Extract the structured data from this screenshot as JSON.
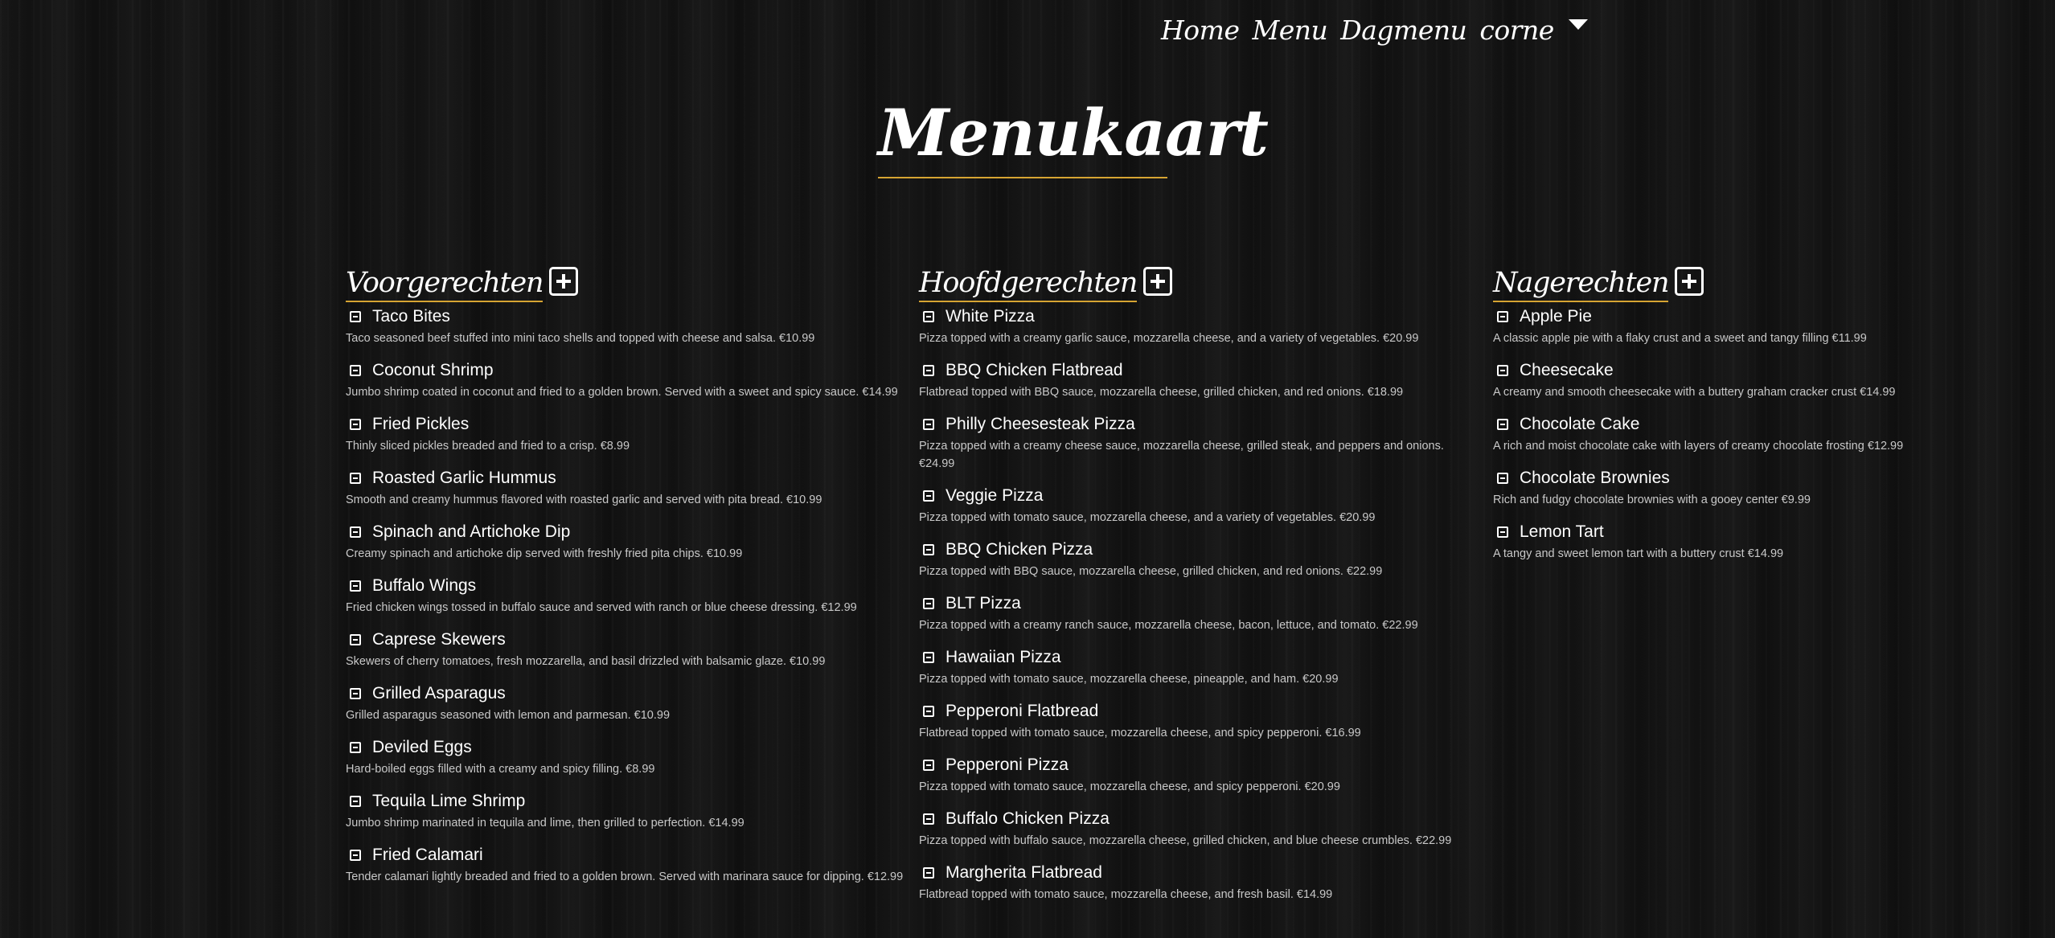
{
  "nav": {
    "items": [
      "Home",
      "Menu",
      "Dagmenu",
      "corne"
    ]
  },
  "page": {
    "title": "Menukaart"
  },
  "colors": {
    "accent": "#d6a432",
    "background": "#141414",
    "text": "#ffffff"
  },
  "categories": [
    {
      "title": "Voorgerechten",
      "items": [
        {
          "name": "Taco Bites",
          "desc": "Taco seasoned beef stuffed into mini taco shells and topped with cheese and salsa. €10.99"
        },
        {
          "name": "Coconut Shrimp",
          "desc": "Jumbo shrimp coated in coconut and fried to a golden brown. Served with a sweet and spicy sauce. €14.99"
        },
        {
          "name": "Fried Pickles",
          "desc": "Thinly sliced pickles breaded and fried to a crisp. €8.99"
        },
        {
          "name": "Roasted Garlic Hummus",
          "desc": "Smooth and creamy hummus flavored with roasted garlic and served with pita bread. €10.99"
        },
        {
          "name": "Spinach and Artichoke Dip",
          "desc": "Creamy spinach and artichoke dip served with freshly fried pita chips. €10.99"
        },
        {
          "name": "Buffalo Wings",
          "desc": "Fried chicken wings tossed in buffalo sauce and served with ranch or blue cheese dressing. €12.99"
        },
        {
          "name": "Caprese Skewers",
          "desc": "Skewers of cherry tomatoes, fresh mozzarella, and basil drizzled with balsamic glaze. €10.99"
        },
        {
          "name": "Grilled Asparagus",
          "desc": "Grilled asparagus seasoned with lemon and parmesan. €10.99"
        },
        {
          "name": "Deviled Eggs",
          "desc": "Hard-boiled eggs filled with a creamy and spicy filling. €8.99"
        },
        {
          "name": "Tequila Lime Shrimp",
          "desc": "Jumbo shrimp marinated in tequila and lime, then grilled to perfection. €14.99"
        },
        {
          "name": "Fried Calamari",
          "desc": "Tender calamari lightly breaded and fried to a golden brown. Served with marinara sauce for dipping. €12.99"
        }
      ]
    },
    {
      "title": "Hoofdgerechten",
      "items": [
        {
          "name": "White Pizza",
          "desc": "Pizza topped with a creamy garlic sauce, mozzarella cheese, and a variety of vegetables. €20.99"
        },
        {
          "name": "BBQ Chicken Flatbread",
          "desc": "Flatbread topped with BBQ sauce, mozzarella cheese, grilled chicken, and red onions. €18.99"
        },
        {
          "name": "Philly Cheesesteak Pizza",
          "desc": "Pizza topped with a creamy cheese sauce, mozzarella cheese, grilled steak, and peppers and onions. €24.99"
        },
        {
          "name": "Veggie Pizza",
          "desc": "Pizza topped with tomato sauce, mozzarella cheese, and a variety of vegetables. €20.99"
        },
        {
          "name": "BBQ Chicken Pizza",
          "desc": "Pizza topped with BBQ sauce, mozzarella cheese, grilled chicken, and red onions. €22.99"
        },
        {
          "name": "BLT Pizza",
          "desc": "Pizza topped with a creamy ranch sauce, mozzarella cheese, bacon, lettuce, and tomato. €22.99"
        },
        {
          "name": "Hawaiian Pizza",
          "desc": "Pizza topped with tomato sauce, mozzarella cheese, pineapple, and ham. €20.99"
        },
        {
          "name": "Pepperoni Flatbread",
          "desc": "Flatbread topped with tomato sauce, mozzarella cheese, and spicy pepperoni. €16.99"
        },
        {
          "name": "Pepperoni Pizza",
          "desc": "Pizza topped with tomato sauce, mozzarella cheese, and spicy pepperoni. €20.99"
        },
        {
          "name": "Buffalo Chicken Pizza",
          "desc": "Pizza topped with buffalo sauce, mozzarella cheese, grilled chicken, and blue cheese crumbles. €22.99"
        },
        {
          "name": "Margherita Flatbread",
          "desc": "Flatbread topped with tomato sauce, mozzarella cheese, and fresh basil. €14.99"
        }
      ]
    },
    {
      "title": "Nagerechten",
      "items": [
        {
          "name": "Apple Pie",
          "desc": "A classic apple pie with a flaky crust and a sweet and tangy filling €11.99"
        },
        {
          "name": "Cheesecake",
          "desc": "A creamy and smooth cheesecake with a buttery graham cracker crust €14.99"
        },
        {
          "name": "Chocolate Cake",
          "desc": "A rich and moist chocolate cake with layers of creamy chocolate frosting €12.99"
        },
        {
          "name": "Chocolate Brownies",
          "desc": "Rich and fudgy chocolate brownies with a gooey center €9.99"
        },
        {
          "name": "Lemon Tart",
          "desc": "A tangy and sweet lemon tart with a buttery crust €14.99"
        }
      ]
    }
  ]
}
